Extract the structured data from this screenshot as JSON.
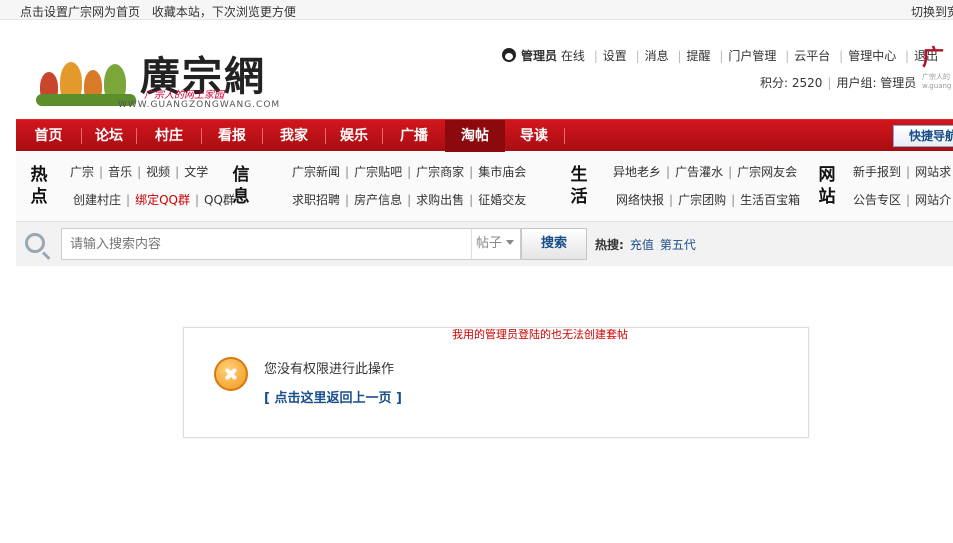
{
  "topbar": {
    "set_home": "点击设置广宗网为首页",
    "bookmark": "收藏本站，下次浏览更方便",
    "switch": "切换到宽"
  },
  "logo": {
    "name": "廣宗網",
    "slogan": "广宗人的网上家园",
    "url": "WWW.GUANGZONGWANG.COM"
  },
  "user": {
    "name": "管理员",
    "status": "在线",
    "links": [
      "设置",
      "消息",
      "提醒",
      "门户管理",
      "云平台",
      "管理中心",
      "退出"
    ],
    "points_label": "积分: 2520",
    "group_label": "用户组: 管理员"
  },
  "corner_logo": {
    "char": "广",
    "text": "广宗人的",
    "url": "w.guang"
  },
  "nav": {
    "items": [
      "首页",
      "论坛",
      "村庄",
      "看报",
      "我家",
      "娱乐",
      "广播",
      "淘帖",
      "导读"
    ],
    "active_index": 7,
    "quick_nav": "快捷导航"
  },
  "panel": {
    "hot": {
      "title": [
        "热",
        "点"
      ],
      "row1": [
        "广宗",
        "音乐",
        "视频",
        "文学"
      ],
      "row2": [
        "创建村庄",
        "绑定QQ群",
        "QQ群"
      ]
    },
    "info": {
      "title": [
        "信",
        "息"
      ],
      "row1": [
        "广宗新闻",
        "广宗贴吧",
        "广宗商家",
        "集市庙会"
      ],
      "row2": [
        "求职招聘",
        "房产信息",
        "求购出售",
        "征婚交友"
      ]
    },
    "life": {
      "title": [
        "生",
        "活"
      ],
      "row1": [
        "异地老乡",
        "广告灌水",
        "广宗网友会"
      ],
      "row2": [
        "网络快报",
        "广宗团购",
        "生活百宝箱"
      ]
    },
    "site": {
      "title": [
        "网",
        "站"
      ],
      "row1": [
        "新手报到",
        "网站求"
      ],
      "row2": [
        "公告专区",
        "网站介"
      ]
    }
  },
  "search": {
    "placeholder": "请输入搜索内容",
    "type": "帖子",
    "button": "搜索",
    "hot_label": "热搜:",
    "hot_keywords": [
      "充值",
      "第五代"
    ]
  },
  "message": {
    "note": "我用的管理员登陆的也无法创建套帖",
    "text": "您没有权限进行此操作",
    "back": "[ 点击这里返回上一页 ]"
  }
}
